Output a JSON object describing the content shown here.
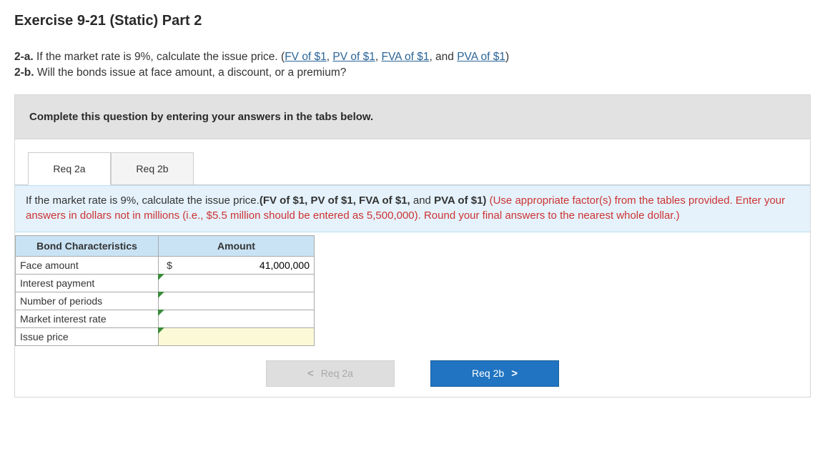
{
  "title": "Exercise 9-21 (Static) Part 2",
  "prompt": {
    "p2a_prefix": "2-a.",
    "p2a_text": " If the market rate is 9%, calculate the issue price. (",
    "link_fv": "FV of $1",
    "link_pv": "PV of $1",
    "link_fva": "FVA of $1",
    "link_pva": "PVA of $1",
    "p2a_suffix": ")",
    "p2b_prefix": "2-b.",
    "p2b_text": " Will the bonds issue at face amount, a discount, or a premium?",
    "comma": ", ",
    "and": ", and "
  },
  "instruction": "Complete this question by entering your answers in the tabs below.",
  "tabs": {
    "t1": "Req 2a",
    "t2": "Req 2b"
  },
  "note": {
    "part1": "If the market rate is 9%, calculate the issue price.",
    "bold1": "(FV of $1, PV of $1, FVA of $1,",
    "and": " and ",
    "bold2": "PVA of $1)",
    "red": " (Use appropriate factor(s) from the tables provided. Enter your answers in dollars not in millions (i.e., $5.5 million should be entered as 5,500,000). Round your final answers to the nearest whole dollar.)"
  },
  "table": {
    "h1": "Bond Characteristics",
    "h2": "Amount",
    "rows": {
      "r0": {
        "label": "Face amount",
        "dollar": "$",
        "value": "41,000,000"
      },
      "r1": {
        "label": "Interest payment",
        "value": ""
      },
      "r2": {
        "label": "Number of periods",
        "value": ""
      },
      "r3": {
        "label": "Market interest rate",
        "value": ""
      },
      "r4": {
        "label": "Issue price",
        "value": ""
      }
    }
  },
  "nav": {
    "prev": "Req 2a",
    "next": "Req 2b",
    "lt": "<",
    "gt": ">"
  }
}
